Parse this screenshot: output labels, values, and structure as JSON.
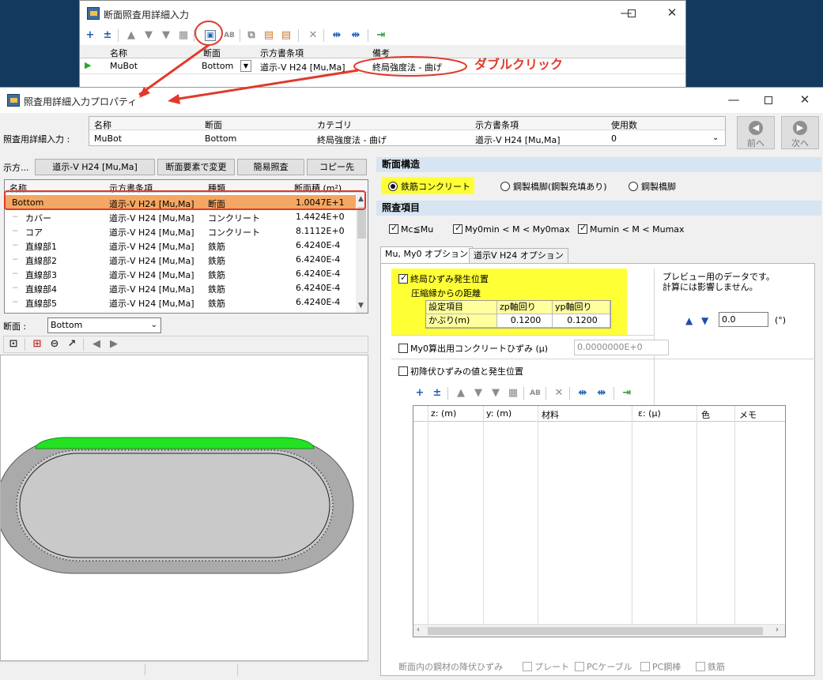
{
  "back_window": {
    "title": "断面照査用詳細入力",
    "columns": [
      "名称",
      "断面",
      "示方書条項",
      "備考"
    ],
    "row": {
      "name": "MuBot",
      "section": "Bottom",
      "spec": "道示-V H24 [Mu,Ma]",
      "remark": "終局強度法 - 曲げ"
    }
  },
  "annotation": {
    "text": "ダブルクリック",
    "color": "#e03a2a"
  },
  "front_window": {
    "title": "照査用詳細入力プロパティ",
    "header": {
      "row_label": "照査用詳細入力 :",
      "columns": [
        "名称",
        "断面",
        "カテゴリ",
        "示方書条項",
        "使用数"
      ],
      "values": [
        "MuBot",
        "Bottom",
        "終局強度法 - 曲げ",
        "道示-V H24 [Mu,Ma]",
        "0"
      ]
    },
    "nav": {
      "prev": "前へ",
      "next": "次へ"
    },
    "left_buttons": {
      "label": "示方...",
      "spec": "道示-V H24 [Mu,Ma]",
      "change": "断面要素で変更",
      "simple": "簡易照査",
      "copy": "コピー先"
    },
    "list": {
      "headers": [
        "名称",
        "示方書条項",
        "種類",
        "断面積 (m²)"
      ],
      "rows": [
        {
          "name": "Bottom",
          "spec": "道示-V H24 [Mu,Ma]",
          "kind": "断面",
          "area": "1.0047E+1"
        },
        {
          "name": "カバー",
          "spec": "道示-V H24 [Mu,Ma]",
          "kind": "コンクリート",
          "area": "1.4424E+0"
        },
        {
          "name": "コア",
          "spec": "道示-V H24 [Mu,Ma]",
          "kind": "コンクリート",
          "area": "8.1112E+0"
        },
        {
          "name": "直線部1",
          "spec": "道示-V H24 [Mu,Ma]",
          "kind": "鉄筋",
          "area": "6.4240E-4"
        },
        {
          "name": "直線部2",
          "spec": "道示-V H24 [Mu,Ma]",
          "kind": "鉄筋",
          "area": "6.4240E-4"
        },
        {
          "name": "直線部3",
          "spec": "道示-V H24 [Mu,Ma]",
          "kind": "鉄筋",
          "area": "6.4240E-4"
        },
        {
          "name": "直線部4",
          "spec": "道示-V H24 [Mu,Ma]",
          "kind": "鉄筋",
          "area": "6.4240E-4"
        },
        {
          "name": "直線部5",
          "spec": "道示-V H24 [Mu,Ma]",
          "kind": "鉄筋",
          "area": "6.4240E-4"
        }
      ]
    },
    "section_select": {
      "label": "断面 :",
      "value": "Bottom"
    },
    "right": {
      "structure_title": "断面構造",
      "structure_options": [
        "鉄筋コンクリート",
        "鋼製橋脚(鋼製充填あり)",
        "鋼製橋脚"
      ],
      "check_title": "照査項目",
      "check_items": [
        "Mc≦Mu",
        "My0min < M < My0max",
        "Mumin < M < Mumax"
      ],
      "tabs": [
        "Mu, My0 オプション",
        "道示V H24 オプション"
      ],
      "ultimate": {
        "label": "終局ひずみ発生位置",
        "sub": "圧縮縁からの距離",
        "table_headers": [
          "設定項目",
          "zp軸回り",
          "yp軸回り"
        ],
        "table_row": [
          "かぶり(m)",
          "0.1200",
          "0.1200"
        ]
      },
      "preview_note_1": "プレビュー用のデータです。",
      "preview_note_2": "計算には影響しません。",
      "angle_value": "0.0",
      "angle_unit": "(°)",
      "my0_label": "My0算出用コンクリートひずみ (μ)",
      "my0_value": "0.0000000E+0",
      "initial_yield_label": "初降伏ひずみの値と発生位置",
      "grid_headers": [
        "z: (m)",
        "y: (m)",
        "材料",
        "ε: (μ)",
        "色",
        "メモ"
      ],
      "yield_row_label": "断面内の鋼材の降伏ひずみ",
      "yield_items": [
        "プレート",
        "PCケーブル",
        "PC鋼棒",
        "鉄筋"
      ]
    }
  }
}
